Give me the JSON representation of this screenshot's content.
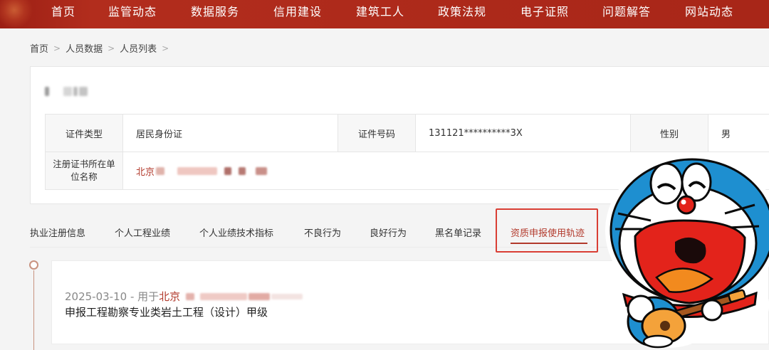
{
  "nav": {
    "items": [
      "首页",
      "监管动态",
      "数据服务",
      "信用建设",
      "建筑工人",
      "政策法规",
      "电子证照",
      "问题解答",
      "网站动态"
    ]
  },
  "breadcrumb": [
    "首页",
    "人员数据",
    "人员列表"
  ],
  "person": {
    "id_type_label": "证件类型",
    "id_type_value": "居民身份证",
    "id_no_label": "证件号码",
    "id_no_value": "131121**********3X",
    "gender_label": "性别",
    "gender_value": "男",
    "company_label": "注册证书所在单位名称",
    "company_value_visible": "北京"
  },
  "tabs": [
    "执业注册信息",
    "个人工程业绩",
    "个人业绩技术指标",
    "不良行为",
    "良好行为",
    "黑名单记录",
    "资质申报使用轨迹"
  ],
  "active_tab": "资质申报使用轨迹",
  "record": {
    "date_prefix": "2025-03-10 - 用于",
    "location": "北京",
    "title": "申报工程勘察专业类岩土工程（设计）甲级"
  },
  "colors": {
    "nav_bg": "#a82618",
    "accent": "#b23a2c",
    "highlight_box": "#d93e34"
  },
  "icons": [
    "chevron-right-icon",
    "timeline-dot-icon",
    "doraemon-sticker"
  ]
}
